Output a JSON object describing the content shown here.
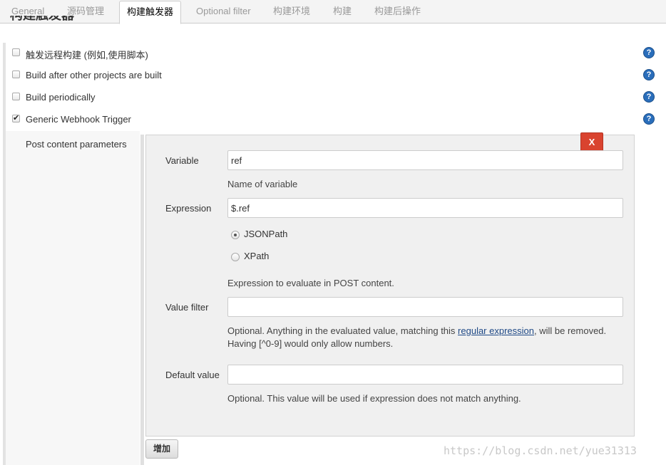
{
  "tabs": [
    {
      "label": "General",
      "active": false
    },
    {
      "label": "源码管理",
      "active": false
    },
    {
      "label": "构建触发器",
      "active": true
    },
    {
      "label": "Optional filter",
      "active": false
    },
    {
      "label": "构建环境",
      "active": false
    },
    {
      "label": "构建",
      "active": false
    },
    {
      "label": "构建后操作",
      "active": false
    }
  ],
  "section": {
    "title": "构建触发器"
  },
  "triggers": [
    {
      "label": "触发远程构建 (例如,使用脚本)",
      "checked": false
    },
    {
      "label": "Build after other projects are built",
      "checked": false
    },
    {
      "label": "Build periodically",
      "checked": false
    },
    {
      "label": "Generic Webhook Trigger",
      "checked": true
    }
  ],
  "help_icon": "question-mark-icon",
  "post_content": {
    "label": "Post content parameters",
    "remove_label": "X",
    "variable": {
      "label": "Variable",
      "value": "ref",
      "description": "Name of variable"
    },
    "expression": {
      "label": "Expression",
      "value": "$.ref",
      "options": [
        {
          "label": "JSONPath",
          "selected": true
        },
        {
          "label": "XPath",
          "selected": false
        }
      ],
      "description": "Expression to evaluate in POST content."
    },
    "value_filter": {
      "label": "Value filter",
      "value": "",
      "desc_before": "Optional. Anything in the evaluated value, matching this ",
      "desc_link": "regular expression",
      "desc_after": ", will be removed.",
      "desc_line2": "Having [^0-9] would only allow numbers."
    },
    "default_value": {
      "label": "Default value",
      "value": "",
      "description": "Optional. This value will be used if expression does not match anything."
    },
    "add_label": "增加"
  },
  "watermark": "https://blog.csdn.net/yue31313",
  "colors": {
    "remove_button": "#d9432f",
    "help_icon": "#2a6ebb",
    "link": "#204a87"
  }
}
